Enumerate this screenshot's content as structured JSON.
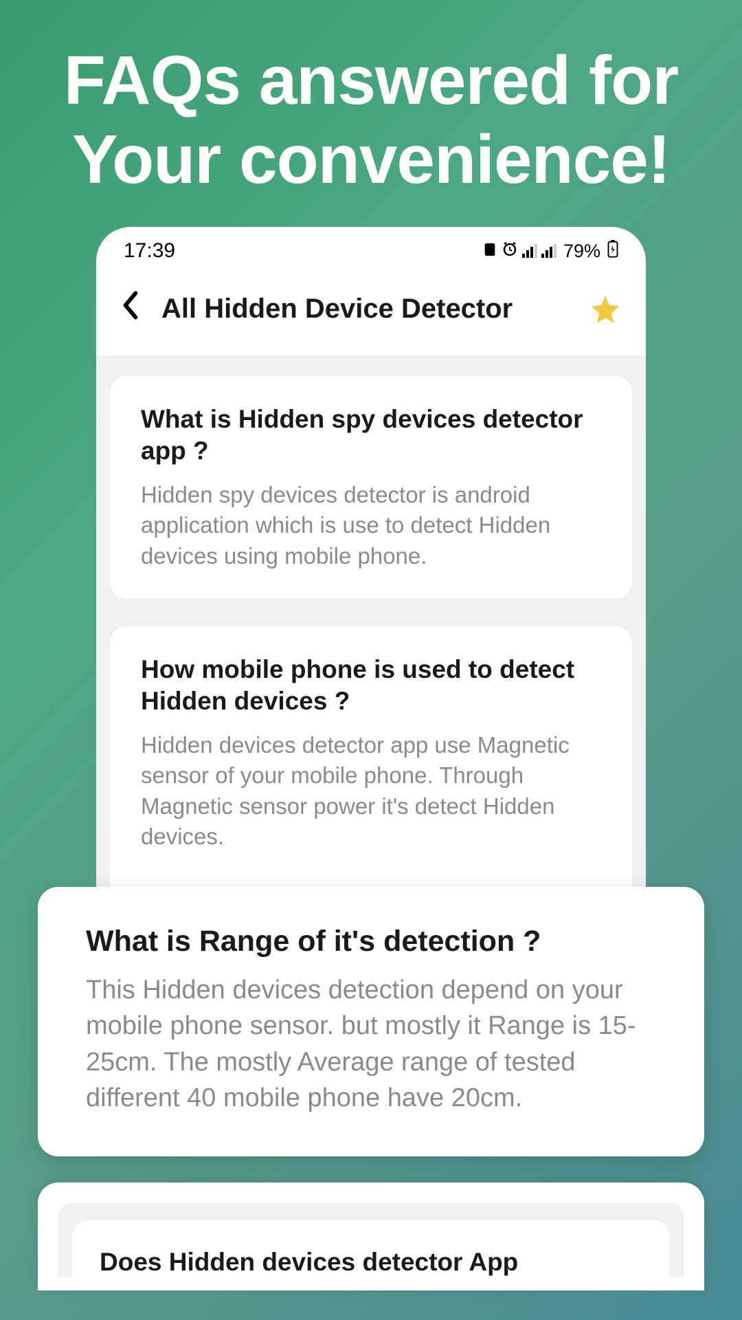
{
  "hero": {
    "title": "FAQs answered for Your convenience!"
  },
  "statusbar": {
    "time": "17:39",
    "battery": "79%"
  },
  "header": {
    "title": "All Hidden Device Detector"
  },
  "faqs": [
    {
      "question": "What is Hidden spy devices detector app ?",
      "answer": "Hidden spy devices detector is android application which is use to detect Hidden devices using mobile phone."
    },
    {
      "question": "How mobile phone is used to detect Hidden devices ?",
      "answer": "Hidden devices detector app use Magnetic sensor of your mobile phone. Through Magnetic sensor power it's detect Hidden devices."
    }
  ],
  "popout": {
    "question": "What is Range of it's detection ?",
    "answer": "This Hidden devices detection depend on your mobile phone sensor. but mostly it Range is 15-25cm. The mostly Average range of tested different 40 mobile phone have 20cm."
  },
  "peek": {
    "question": "Does Hidden devices detector App"
  }
}
